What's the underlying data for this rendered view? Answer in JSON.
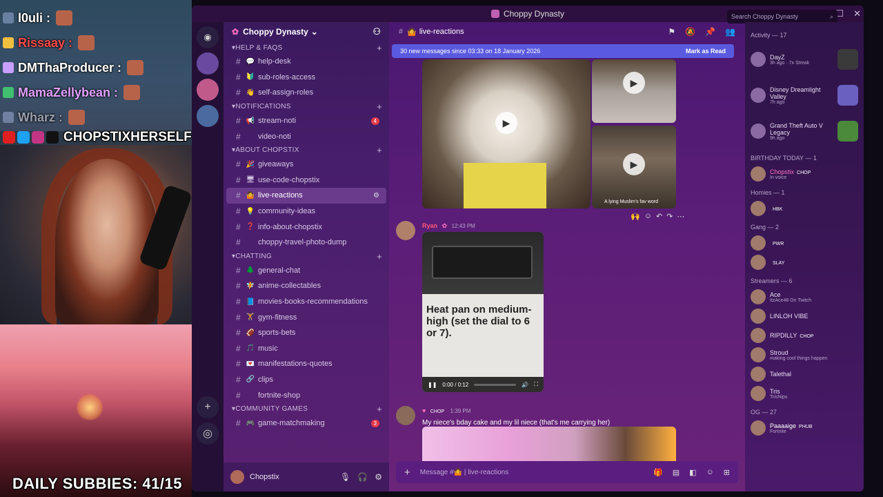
{
  "overlay": {
    "chat": [
      {
        "name": "l0uli :",
        "color": "#ffffff",
        "badge": "#6a80a0"
      },
      {
        "name": "Rissaay :",
        "color": "#ff4a4a",
        "badge": "#f0c040"
      },
      {
        "name": "DMThaProducer :",
        "color": "#ffffff",
        "badge": "#c8a0ff"
      },
      {
        "name": "MamaZellybean :",
        "color": "#e0a0ff",
        "badge": "#40c070"
      },
      {
        "name": "Wharz :",
        "color": "#9aa0b0",
        "badge": "#7080a0"
      }
    ],
    "handle": "CHOPSTIXHERSELF",
    "subbies": "DAILY SUBBIES: 41/15"
  },
  "window": {
    "title": "Choppy Dynasty"
  },
  "server": {
    "name": "Choppy Dynasty"
  },
  "categories": [
    {
      "label": "HELP & FAQS",
      "channels": [
        {
          "emoji": "💬",
          "label": "help-desk"
        },
        {
          "emoji": "🔰",
          "label": "sub-roles-access"
        },
        {
          "emoji": "👋",
          "label": "self-assign-roles"
        }
      ]
    },
    {
      "label": "NOTIFICATIONS",
      "channels": [
        {
          "emoji": "📢",
          "label": "stream-noti",
          "badge": "4"
        },
        {
          "emoji": "",
          "label": "video-noti"
        }
      ]
    },
    {
      "label": "ABOUT CHOPSTIX",
      "channels": [
        {
          "emoji": "🎉",
          "label": "giveaways"
        },
        {
          "emoji": "🖥",
          "label": "use-code-chopstix"
        },
        {
          "emoji": "🤷",
          "label": "live-reactions",
          "active": true
        },
        {
          "emoji": "💡",
          "label": "community-ideas"
        },
        {
          "emoji": "❓",
          "label": "info-about-chopstix"
        },
        {
          "emoji": "",
          "label": "choppy-travel-photo-dump"
        }
      ]
    },
    {
      "label": "CHATTING",
      "channels": [
        {
          "emoji": "🌲",
          "label": "general-chat"
        },
        {
          "emoji": "🧚",
          "label": "anime-collectables"
        },
        {
          "emoji": "📘",
          "label": "movies-books-recommendations"
        },
        {
          "emoji": "🏋",
          "label": "gym-fitness"
        },
        {
          "emoji": "🏈",
          "label": "sports-bets"
        },
        {
          "emoji": "🎵",
          "label": "music"
        },
        {
          "emoji": "💌",
          "label": "manifestations-quotes"
        },
        {
          "emoji": "🔗",
          "label": "clips"
        },
        {
          "emoji": "",
          "label": "fortnite-shop"
        }
      ]
    },
    {
      "label": "COMMUNITY GAMES",
      "channels": [
        {
          "emoji": "🎮",
          "label": "game-matchmaking",
          "badge": "3"
        }
      ]
    }
  ],
  "user": {
    "name": "Chopstix"
  },
  "channel": {
    "name": "live-reactions",
    "new_messages": "30 new messages since 03:33 on 18 January 2026",
    "mark_read": "Mark as Read",
    "media_caption": "A lying Muslim's fav word",
    "msg1": {
      "author": "Ryan",
      "time": "12:43 PM"
    },
    "video": {
      "text": "Heat pan on medium-high (set the dial to 6 or 7).",
      "time": "0:00 / 0:12"
    },
    "msg2": {
      "tag": "CHOP",
      "time": "1:39 PM",
      "text": "My niece's bday cake and my lil niece (that's me carrying her)"
    },
    "placeholder": "Message #🤷 | live-reactions"
  },
  "search": {
    "placeholder": "Search Choppy Dynasty"
  },
  "members": {
    "activity_header": "Activity — 17",
    "activities": [
      {
        "name": "DayZ",
        "sub": "3h ago · 7x Streak",
        "game": "#3a3a3a"
      },
      {
        "name": "Disney Dreamlight Valley",
        "sub": "7h ago",
        "game": "#6a60c0"
      },
      {
        "name": "Grand Theft Auto V Legacy",
        "sub": "9h ago",
        "game": "#4a8a3a"
      }
    ],
    "groups": [
      {
        "header": "BIRTHDAY TODAY — 1",
        "items": [
          {
            "name": "Chopstix",
            "sub": "In voice",
            "color": "#ff70c0",
            "tag": "CHOP"
          }
        ]
      },
      {
        "header": "Homies — 1",
        "items": [
          {
            "name": "",
            "sub": "",
            "color": "#ff3a3a",
            "tag": "HBK"
          }
        ]
      },
      {
        "header": "Gang — 2",
        "items": [
          {
            "name": "",
            "sub": "",
            "color": "#3a5aff",
            "tag": "PWR"
          },
          {
            "name": "",
            "sub": "",
            "color": "#3a5aff",
            "tag": "SLAY"
          }
        ]
      },
      {
        "header": "Streamers — 6",
        "items": [
          {
            "name": "Ace",
            "sub": "ItzAce48 On Twitch",
            "color": "#e8dcf4",
            "tag": ""
          },
          {
            "name": "LINLOH VIBE",
            "sub": "",
            "color": "#e8dcf4",
            "tag": ""
          },
          {
            "name": "RIPDILLY",
            "sub": "",
            "color": "#e8dcf4",
            "tag": "CHOP"
          },
          {
            "name": "Stroud",
            "sub": "making cool things happen",
            "color": "#e8dcf4",
            "tag": ""
          },
          {
            "name": "Talethal",
            "sub": "",
            "color": "#e8dcf4",
            "tag": ""
          },
          {
            "name": "Tris",
            "sub": "TrisNips",
            "color": "#e8dcf4",
            "tag": ""
          }
        ]
      },
      {
        "header": "OG — 27",
        "items": [
          {
            "name": "Paaaaige",
            "sub": "Fortnite",
            "color": "#ffffff",
            "tag": "PHUB"
          }
        ]
      }
    ]
  }
}
